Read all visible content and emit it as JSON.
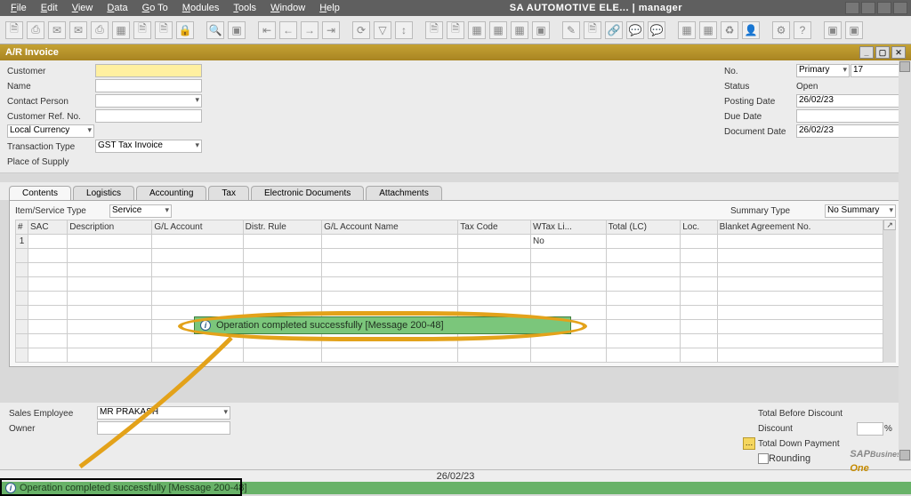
{
  "menubar": {
    "items": [
      "File",
      "Edit",
      "View",
      "Data",
      "Go To",
      "Modules",
      "Tools",
      "Window",
      "Help"
    ],
    "title": "SA AUTOMOTIVE ELE... | manager"
  },
  "window": {
    "title": "A/R Invoice"
  },
  "form_left": [
    {
      "label": "Customer",
      "value": ""
    },
    {
      "label": "Name",
      "value": ""
    },
    {
      "label": "Contact Person",
      "value": ""
    },
    {
      "label": "Customer Ref. No.",
      "value": ""
    },
    {
      "label": "Local Currency",
      "value": ""
    },
    {
      "label": "Transaction Type",
      "value": "GST Tax Invoice"
    },
    {
      "label": "Place of Supply",
      "value": ""
    }
  ],
  "form_right": {
    "no_label": "No.",
    "no_type": "Primary",
    "no_val": "17",
    "status_label": "Status",
    "status_val": "Open",
    "posting_label": "Posting Date",
    "posting_val": "26/02/23",
    "due_label": "Due Date",
    "due_val": "",
    "doc_label": "Document Date",
    "doc_val": "26/02/23"
  },
  "tabs": [
    "Contents",
    "Logistics",
    "Accounting",
    "Tax",
    "Electronic Documents",
    "Attachments"
  ],
  "items_row": {
    "label": "Item/Service Type",
    "value": "Service",
    "summary_label": "Summary Type",
    "summary_val": "No Summary"
  },
  "grid": {
    "cols": [
      "#",
      "SAC",
      "Description",
      "G/L Account",
      "Distr. Rule",
      "G/L Account Name",
      "Tax Code",
      "WTax Li...",
      "Total (LC)",
      "Loc.",
      "Blanket Agreement No."
    ],
    "rows": [
      {
        "n": "1",
        "sac": "",
        "desc": "",
        "gl": "",
        "dr": "",
        "gln": "",
        "tax": "",
        "wtax": "No",
        "total": "",
        "loc": "",
        "blanket": ""
      }
    ]
  },
  "callout": {
    "msg": "Operation completed successfully  [Message 200-48]"
  },
  "bottom_left": [
    {
      "label": "Sales Employee",
      "value": "MR PRAKASH"
    },
    {
      "label": "Owner",
      "value": ""
    }
  ],
  "bottom_right": {
    "total_before": "Total Before Discount",
    "discount": "Discount",
    "pct": "%",
    "tdp": "Total Down Payment",
    "rounding": "Rounding"
  },
  "status": {
    "date": "26/02/23",
    "msg": "Operation completed successfully  [Message 200-48]"
  },
  "logo": {
    "a": "SAP",
    "b": "Business",
    "c": "One"
  }
}
